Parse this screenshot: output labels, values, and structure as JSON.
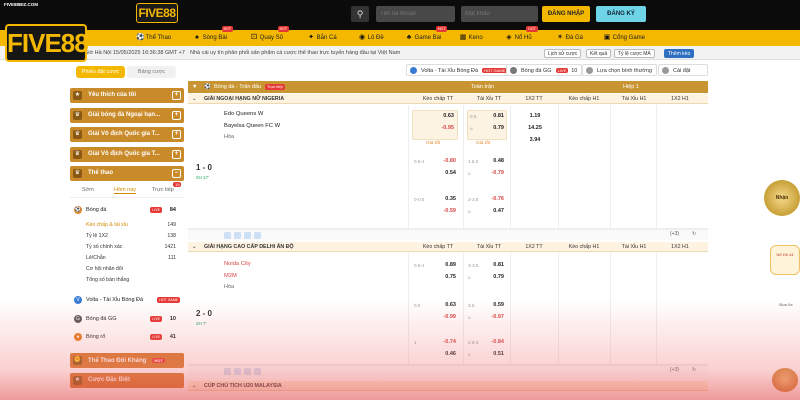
{
  "header": {
    "brand": "FIVE88",
    "small_logo_text": "FIVE88BIZ.COM",
    "big_logo": "FIVE88",
    "search_icon": "search-icon",
    "username_placeholder": "Tên tài khoản",
    "password_placeholder": "Mật khẩu",
    "login_label": "ĐĂNG NHẬP",
    "register_label": "ĐĂNG KÝ"
  },
  "menu": [
    {
      "label": "Thể Thao",
      "icon": "soccer-icon",
      "hot": ""
    },
    {
      "label": "Sòng Bài",
      "icon": "cards-icon",
      "hot": "HOT"
    },
    {
      "label": "Quay Số",
      "icon": "dice-icon",
      "hot": "HOT"
    },
    {
      "label": "Bắn Cá",
      "icon": "fish-icon",
      "hot": ""
    },
    {
      "label": "Lô Đề",
      "icon": "lottery-icon",
      "hot": ""
    },
    {
      "label": "Game Bài",
      "icon": "cards-icon",
      "hot": "HOT"
    },
    {
      "label": "Keno",
      "icon": "keno-icon",
      "hot": ""
    },
    {
      "label": "Nổ Hũ",
      "icon": "jar-icon",
      "hot": "HOT"
    },
    {
      "label": "Đá Gà",
      "icon": "rooster-icon",
      "hot": ""
    },
    {
      "label": "Cổng Game",
      "icon": "gamepad-icon",
      "hot": ""
    }
  ],
  "infobar": {
    "datetime": "Giờ Hà Nội 15/05/2025 16:36:38 GMT +7",
    "marquee": "Nhà cái uy tín phân phối sản phẩm cá cược thể thao trực tuyến hàng đầu tại Việt Nam",
    "chips": [
      "Lịch sử cược",
      "Kết quả",
      "Tỷ lệ cược MA",
      "Thêm kèo"
    ]
  },
  "left": {
    "tabs": [
      "Phiếu đặt cược",
      "Bảng cược"
    ],
    "sections": [
      "Yêu thích của tôi",
      "Giải bóng đá Ngoại hạn...",
      "Giải Vô địch Quốc gia T...",
      "Giải Vô địch Quốc gia T...",
      "Thể thao"
    ],
    "day_tabs": [
      "Sớm",
      "Hôm nay",
      "Trực tiếp"
    ],
    "day_badge": "19",
    "football": {
      "label": "Bóng đá",
      "tag": "LIVE",
      "count": "84"
    },
    "sub_items": [
      {
        "label": "Kèo chấp & tài xỉu",
        "count": "149"
      },
      {
        "label": "Tỷ lệ 1X2",
        "count": "138"
      },
      {
        "label": "Tỷ số chính xác",
        "count": "1421"
      },
      {
        "label": "Lẻ/Chẵn",
        "count": "111"
      },
      {
        "label": "Cơ hội nhân đôi",
        "count": ""
      },
      {
        "label": "Tổng số bàn thắng",
        "count": ""
      }
    ],
    "virtual": {
      "label": "Volta - Tài Xỉu Bóng Đá",
      "tag": "HOT GAME"
    },
    "esports": {
      "label": "Bóng đá GG",
      "tag": "LIVE",
      "count": "10"
    },
    "basketball": {
      "label": "Bóng rổ",
      "tag": "LIVE",
      "count": "41"
    },
    "bottom_sections": [
      "Thể Thao Đối Kháng",
      "Cược Đặc Biệt"
    ],
    "bottom_hot": "HOT"
  },
  "main": {
    "top_buttons": [
      {
        "label": "Volta - Tài Xỉu Bóng Đá",
        "tag": "HOT GAME"
      },
      {
        "label": "Bóng đá GG",
        "tag": "LIVE",
        "num": "10"
      },
      {
        "label": "Lựa chọn bình thường",
        "tag": ""
      },
      {
        "label": "Cài đặt cược",
        "tag": ""
      }
    ],
    "title_bar": {
      "sport": "Bóng đá - Trận đấu",
      "live_tag": "Trực tiếp",
      "full_time": "Toàn trận",
      "half": "Hiệp 1"
    },
    "col_headers": [
      "Kèo chấp TT",
      "Tài Xỉu TT",
      "1X2 TT",
      "Kèo chấp H1",
      "Tài Xỉu H1",
      "1X2 H1"
    ],
    "leagues": [
      {
        "name": "GIẢI NGOẠI HẠNG NỮ NIGERIA",
        "score": "1 - 0",
        "time": "2H 17'",
        "home": "Edo Queens W",
        "away": "Bayelsa Queen FC W",
        "draw": "Hòa",
        "rows": [
          {
            "hc": "",
            "h1": "0.63",
            "ou": "0.5",
            "o1": "0.81",
            "x": "1.19",
            "h2": "-0.95",
            "u": "u",
            "o2": "0.79",
            "x2": "14.25",
            "x3": "3.94",
            "best": "Giá tốt"
          },
          {
            "hc": "0.5-1",
            "h1": "-0.80",
            "ou": "1.5-2",
            "o1": "0.48",
            "h2": "0.54",
            "u": "u",
            "o2": "-0.79"
          },
          {
            "hc": "0-0.5",
            "h1": "0.35",
            "ou": "2-2.5",
            "o1": "-0.76",
            "h2": "-0.59",
            "u": "u",
            "o2": "0.47"
          }
        ]
      },
      {
        "name": "GIẢI HẠNG CAO CẤP DELHI ẤN ĐỘ",
        "score": "2 - 0",
        "time": "2H 7'",
        "home": "Noida City",
        "away": "M2M",
        "draw": "Hòa",
        "rows": [
          {
            "hc": "0.5-1",
            "h1": "0.89",
            "ou": "3-3.5",
            "o1": "0.81",
            "h2": "0.75",
            "u": "u",
            "o2": "0.79"
          },
          {
            "hc": "0.5",
            "h1": "0.63",
            "ou": "3.5",
            "o1": "0.59",
            "h2": "-0.99",
            "u": "u",
            "o2": "-0.97"
          },
          {
            "hc": "1",
            "h1": "-0.74",
            "ou": "2.5-3",
            "o1": "-0.84",
            "h2": "0.46",
            "u": "u",
            "o2": "0.51"
          }
        ]
      },
      {
        "name": "CÚP CHỦ TỊCH U20 MALAYSIA"
      }
    ],
    "more_count": "(+3)",
    "more_count2": "(+3)"
  },
  "side": {
    "ad1": "Nhận",
    "ad2": "Nổ Hũ 44",
    "ad3": "Đua Xe"
  },
  "colors": {
    "accent": "#f5b800",
    "section": "#c98a2a",
    "red": "#d64545"
  }
}
